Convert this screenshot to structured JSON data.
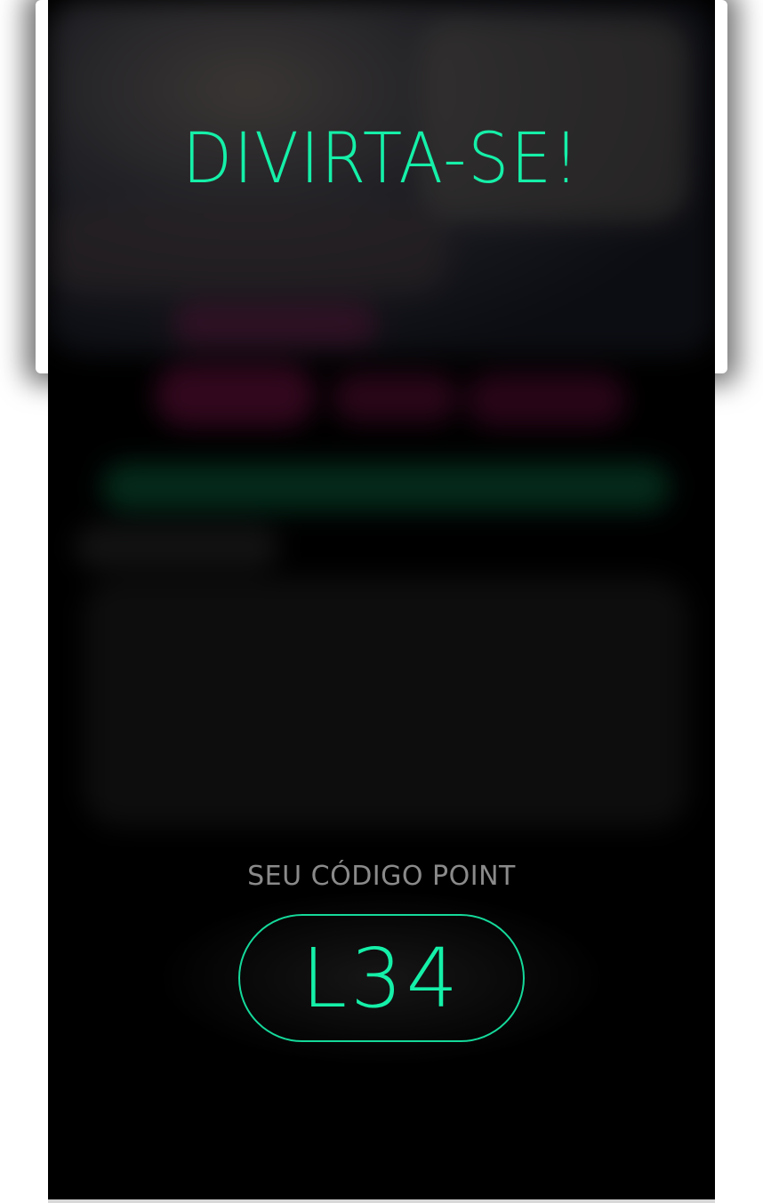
{
  "screen": {
    "title": "DIVIRTA-SE!",
    "code_label": "SEU CÓDIGO POINT",
    "code_value": "L34"
  },
  "colors": {
    "accent": "#15f0a8",
    "background": "#000000",
    "label": "#8a8a8a"
  }
}
